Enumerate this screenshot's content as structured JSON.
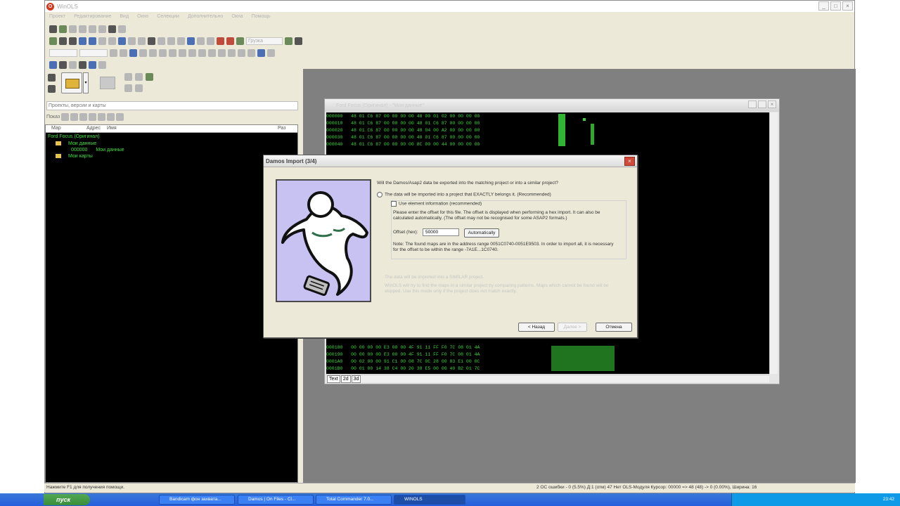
{
  "app": {
    "title": "WinOLS",
    "menu": [
      "Проект",
      "Редактирование",
      "Вид",
      "Окно",
      "Селекции",
      "Дополнительно",
      "Окна",
      "Помощь"
    ],
    "zoom_combo": "Грузка"
  },
  "left_panel": {
    "projects_combo": "Проекты, версии и карты",
    "maps_label": "Показ",
    "columns": [
      "Map",
      "Адрес",
      "Имя",
      "Раз"
    ],
    "tree": [
      {
        "label": "Ford Focus (Оригинал)",
        "level": 0
      },
      {
        "label": "Мои данные",
        "level": 1,
        "folder": true
      },
      {
        "label": "000000",
        "value": "Мои данные",
        "level": 2
      },
      {
        "label": "Мои карты",
        "level": 1,
        "folder": true
      }
    ]
  },
  "hex_window": {
    "title": "Ford Focus (Оригинал) - \"Мои данные\"",
    "rows_top": [
      {
        "addr": "000000",
        "bytes": "48 01 C6 87 00 00 00 00 48 00 01 02 00 00 00 00"
      },
      {
        "addr": "000010",
        "bytes": "48 01 C6 87 00 00 00 00 48 01 C6 87 00 00 00 00"
      },
      {
        "addr": "000020",
        "bytes": "48 01 C6 87 00 00 00 00 48 04 00 A2 00 00 00 00"
      },
      {
        "addr": "000030",
        "bytes": "48 01 C6 87 00 00 00 00 48 01 C6 87 00 00 00 00"
      },
      {
        "addr": "000040",
        "bytes": "48 01 C6 87 00 00 00 00 8C 00 00 44 00 00 00 00"
      }
    ],
    "rows_bottom": [
      {
        "addr": "000180",
        "bytes": "00 00 00 00 E3 00 00 4F 91 11 FF F0 7C 08 01 4A"
      },
      {
        "addr": "000190",
        "bytes": "00 00 00 00 E3 00 00 4F 91 11 FF F0 7C 08 01 4A"
      },
      {
        "addr": "0001A0",
        "bytes": "00 02 00 00 91 C1 00 08 7C 0C 28 00 83 E1 00 0C"
      },
      {
        "addr": "0001B0",
        "bytes": "00 01 00 14 38 C4 00 20 38 E5 00 00 40 B2 01 7C"
      },
      {
        "addr": "0001C0",
        "bytes": "38 00 00 00 00 00 00 00 00 00 00 00 00 00 00 00"
      }
    ],
    "tabs": [
      "Text",
      "2d",
      "3d"
    ]
  },
  "dialog": {
    "title": "Damos Import (3/4)",
    "question": "Will the Damos/Asap2 data be exported into the matching project or into a similar project?",
    "option_exact": "The data will be imported into a project that EXACTLY belongs it. (Recommended)",
    "use_element_info": "Use element information (recommended)",
    "offset_hint": "Please enter the offset for this file. The offset is displayed when performing a hex import. It can also be calculated automatically. (The offset may not be recognised for some ASAP2 formats.)",
    "offset_label": "Offset (hex):",
    "offset_value": "50000",
    "automatically_button": "Automatically",
    "note": "Note: The found maps are in the address range 0051C0740-0051E9503. In order to import all, it is necessary for the offset to be within the range -7A1E...1C0740.",
    "option_similar": "The data will be imported into a SIMILAR project.",
    "similar_hint": "WinOLS will try to find the maps in a similar project by comparing patterns. Maps which cannot be found will be skipped. Use this mode only if the project does not match exactly.",
    "back_button": "< Назад",
    "next_button": "Далее >",
    "cancel_button": "Отмена"
  },
  "status_bar": {
    "left": "Нажмите F1 для получения помощи.",
    "right": "2 ОС ошибки - 0 (5.5%) Д:1 (отм) 47  Нет OLS-Модуля  Курсор: 00000 => 48 (48) -> 0 (0.00%), Ширина: 16"
  },
  "taskbar": {
    "start": "пуск",
    "tasks": [
      "Bandicam фон захвата...",
      "Damos | On Files - Cl...",
      "Total Commander 7.0...",
      "WINOLS"
    ],
    "clock": "23:42"
  }
}
